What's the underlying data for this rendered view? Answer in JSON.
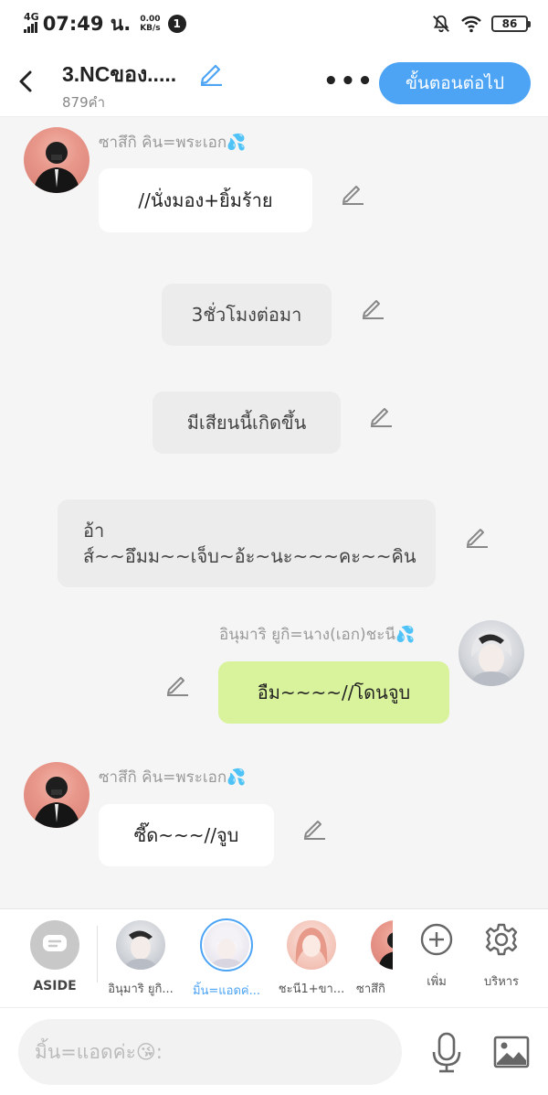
{
  "status_bar": {
    "network": "4G",
    "time": "07:49 น.",
    "speed_value": "0.00",
    "speed_unit": "KB/s",
    "notification_count": "1",
    "battery": "86"
  },
  "header": {
    "title": "3.NCของ.....",
    "word_count": "879คำ",
    "more_label": "•••",
    "next_button": "ขั้นตอนต่อไป"
  },
  "messages": [
    {
      "speaker": "ซาสึกิ คิน=พระเอก💦",
      "text": "//นั่งมอง+ยิ้มร้าย"
    },
    {
      "text": "3ชั่วโมงต่อมา"
    },
    {
      "text": "มีเสียนนี้เกิดขึ้น"
    },
    {
      "text": "อ้าส์~~อึมม~~เจ็บ~อ้ะ~นะ~~~คะ~~คิน"
    },
    {
      "speaker": "อินุมาริ ยูกิ=นาง(เอก)ชะนี💦",
      "text": "อืม~~~~//โดนจูบ"
    },
    {
      "speaker": "ซาสึกิ คิน=พระเอก💦",
      "text": "ซี๊ด~~~//จูบ"
    }
  ],
  "characters": [
    {
      "label": "ASIDE"
    },
    {
      "label": "อินุมาริ ยูกิ..."
    },
    {
      "label": "มิ้น=แอดค่..."
    },
    {
      "label": "ชะนี1+ขา..."
    },
    {
      "label": "ซาสึกิ"
    }
  ],
  "tools": {
    "add_label": "เพิ่ม",
    "manage_label": "บริหาร"
  },
  "input": {
    "placeholder": "มิ้น=แอดค่ะ😘:"
  },
  "colors": {
    "accent": "#4da4f5",
    "green_bubble": "#d9f29c",
    "white_bubble": "#ffffff",
    "grey_bubble": "#ececec"
  }
}
